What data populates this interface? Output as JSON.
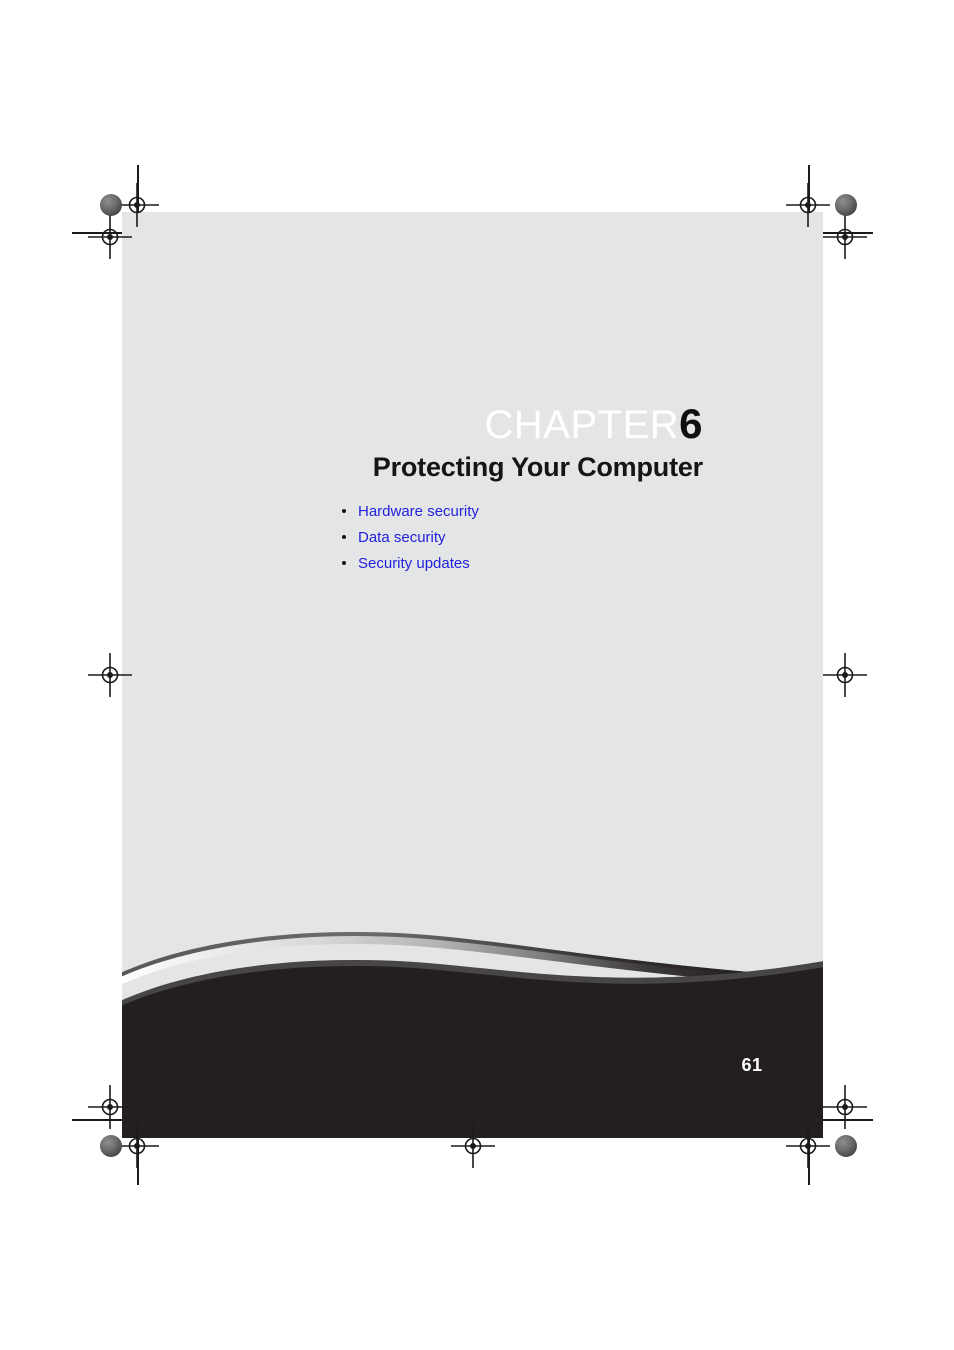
{
  "document": {
    "page_background": "#ffffff",
    "sheet_background": "#e4e5e6",
    "band_color": "#231f20",
    "link_color": "#2222dd",
    "title_color": "#151515"
  },
  "chapter": {
    "eyebrow_word": "CHAPTER",
    "eyebrow_number": "6",
    "title": "Protecting Your Computer"
  },
  "toc": {
    "items": [
      {
        "label": "Hardware security"
      },
      {
        "label": "Data security"
      },
      {
        "label": "Security updates"
      }
    ]
  },
  "footer": {
    "page_number": "61"
  },
  "print_marks": {
    "registration_label": "registration-target",
    "calibration_label": "calibration-dot",
    "crop_label": "crop-rule"
  }
}
